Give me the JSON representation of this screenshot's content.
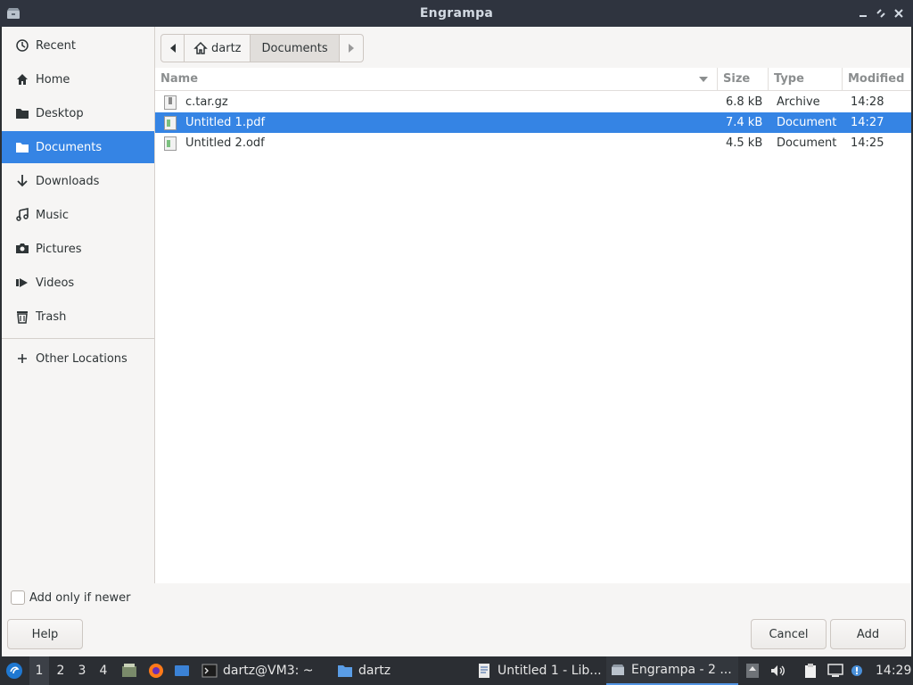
{
  "window": {
    "title": "Engrampa"
  },
  "sidebar": {
    "items": [
      {
        "label": "Recent",
        "icon": "clock-icon"
      },
      {
        "label": "Home",
        "icon": "home-icon"
      },
      {
        "label": "Desktop",
        "icon": "folder-icon"
      },
      {
        "label": "Documents",
        "icon": "folder-icon",
        "active": true
      },
      {
        "label": "Downloads",
        "icon": "download-arrow-icon"
      },
      {
        "label": "Music",
        "icon": "music-note-icon"
      },
      {
        "label": "Pictures",
        "icon": "camera-icon"
      },
      {
        "label": "Videos",
        "icon": "video-icon"
      },
      {
        "label": "Trash",
        "icon": "trash-icon"
      }
    ],
    "other": {
      "label": "Other Locations",
      "icon": "plus-icon"
    }
  },
  "pathbar": {
    "home": "dartz",
    "current": "Documents"
  },
  "columns": {
    "name": "Name",
    "size": "Size",
    "type": "Type",
    "modified": "Modified"
  },
  "files": [
    {
      "name": "c.tar.gz",
      "size": "6.8 kB",
      "type": "Archive",
      "modified": "14:28"
    },
    {
      "name": "Untitled 1.pdf",
      "size": "7.4 kB",
      "type": "Document",
      "modified": "14:27",
      "selected": true
    },
    {
      "name": "Untitled 2.odf",
      "size": "4.5 kB",
      "type": "Document",
      "modified": "14:25"
    }
  ],
  "options": {
    "add_only_if_newer": "Add only if newer"
  },
  "buttons": {
    "help": "Help",
    "cancel": "Cancel",
    "add": "Add"
  },
  "taskbar": {
    "workspaces": [
      "1",
      "2",
      "3",
      "4"
    ],
    "tasks": [
      {
        "label": "dartz@VM3: ~"
      },
      {
        "label": "dartz"
      },
      {
        "label": "Untitled 1 - Lib..."
      },
      {
        "label": "Engrampa - 2 ..."
      }
    ],
    "clock": "14:29"
  },
  "colors": {
    "accent": "#3584e4",
    "titlebar": "#2f343f",
    "taskbar": "#2b2e33"
  }
}
